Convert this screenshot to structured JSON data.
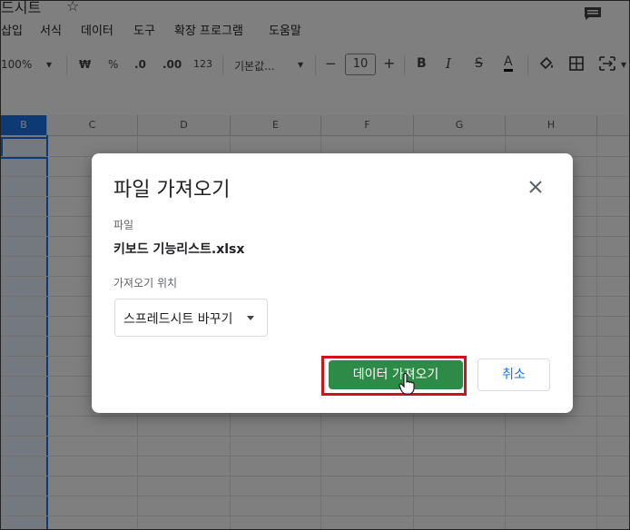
{
  "app": {
    "doc_title": "드시트",
    "menu": [
      "삽입",
      "서식",
      "데이터",
      "도구",
      "확장 프로그램",
      "도움말"
    ]
  },
  "toolbar": {
    "zoom": "100%",
    "currency": "₩",
    "percent": "%",
    "decimal_decrease": ".0",
    "decimal_increase": ".00",
    "number_format": "123",
    "font": "기본값...",
    "font_size": "10",
    "minus": "−",
    "plus": "+",
    "bold": "B",
    "italic": "I",
    "strike": "S",
    "text_color": "A"
  },
  "grid": {
    "columns": [
      "C",
      "D",
      "E",
      "F",
      "G",
      "H"
    ]
  },
  "dialog": {
    "title": "파일 가져오기",
    "file_label": "파일",
    "file_name": "키보드 기능리스트.xlsx",
    "location_label": "가져오기 위치",
    "location_value": "스프레드시트 바꾸기",
    "import_button": "데이터 가져오기",
    "cancel_button": "취소"
  },
  "colors": {
    "primary_green": "#2e8b47",
    "highlight_red": "#d0121b",
    "link_blue": "#1a73e8"
  }
}
